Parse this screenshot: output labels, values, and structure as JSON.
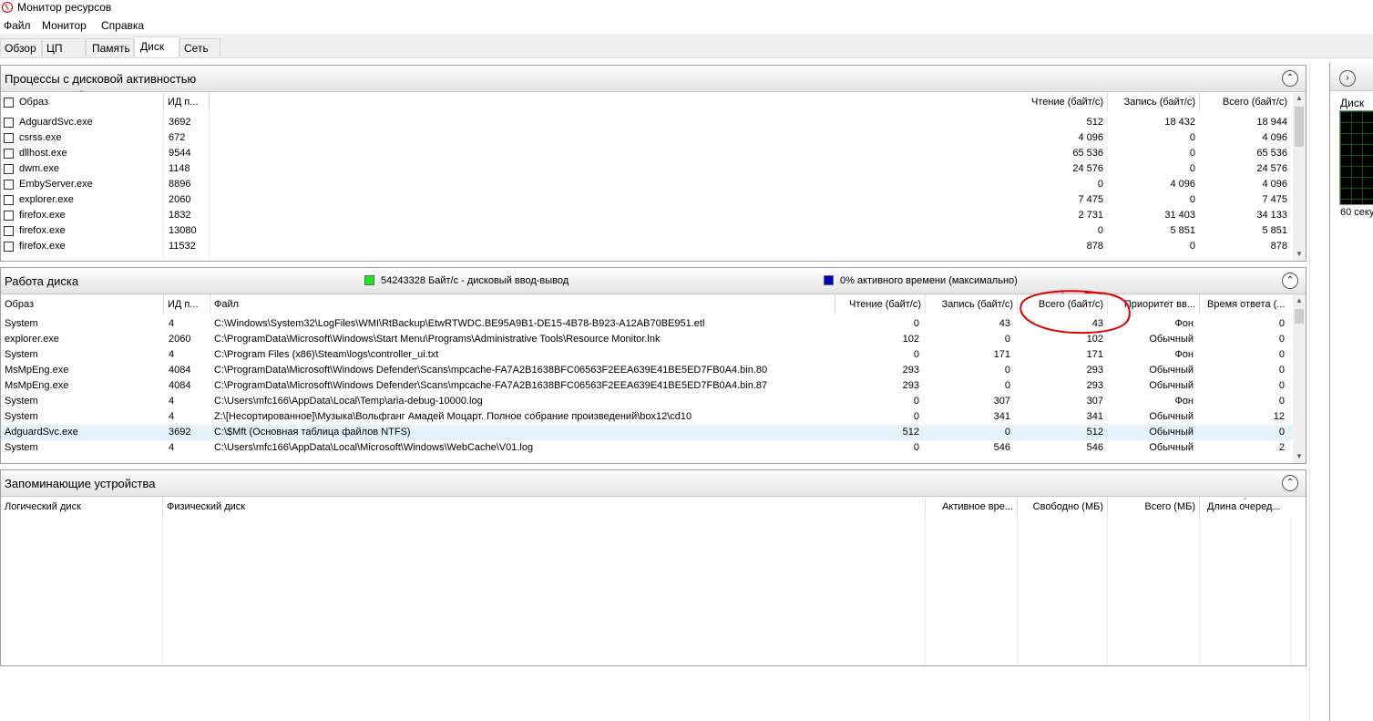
{
  "window": {
    "title": "Монитор ресурсов"
  },
  "menu": [
    "Файл",
    "Монитор",
    "Справка"
  ],
  "tabs": [
    "Обзор",
    "ЦП",
    "Память",
    "Диск",
    "Сеть"
  ],
  "processes": {
    "title": "Процессы с дисковой активностью",
    "columns": [
      "Образ",
      "ИД п...",
      "Чтение (байт/с)",
      "Запись (байт/с)",
      "Всего (байт/с)"
    ],
    "rows": [
      [
        "AdguardSvc.exe",
        "3692",
        "512",
        "18 432",
        "18 944"
      ],
      [
        "csrss.exe",
        "672",
        "4 096",
        "0",
        "4 096"
      ],
      [
        "dllhost.exe",
        "9544",
        "65 536",
        "0",
        "65 536"
      ],
      [
        "dwm.exe",
        "1148",
        "24 576",
        "0",
        "24 576"
      ],
      [
        "EmbyServer.exe",
        "8896",
        "0",
        "4 096",
        "4 096"
      ],
      [
        "explorer.exe",
        "2060",
        "7 475",
        "0",
        "7 475"
      ],
      [
        "firefox.exe",
        "1832",
        "2 731",
        "31 403",
        "34 133"
      ],
      [
        "firefox.exe",
        "13080",
        "0",
        "5 851",
        "5 851"
      ],
      [
        "firefox.exe",
        "11532",
        "878",
        "0",
        "878"
      ]
    ]
  },
  "disk_activity": {
    "title": "Работа диска",
    "io_legend": "54243328 Байт/с - дисковый ввод-вывод",
    "active_legend": "0% активного времени (максимально)",
    "io_color": "#1ee81e",
    "active_color": "#0000c0",
    "columns": [
      "Образ",
      "ИД п...",
      "Файл",
      "Чтение (байт/с)",
      "Запись (байт/с)",
      "Всего (байт/с)",
      "Приоритет вв...",
      "Время ответа (..."
    ],
    "rows": [
      [
        "System",
        "4",
        "C:\\Windows\\System32\\LogFiles\\WMI\\RtBackup\\EtwRTWDC.BE95A9B1-DE15-4B78-B923-A12AB70BE951.etl",
        "0",
        "43",
        "43",
        "Фон",
        "0"
      ],
      [
        "explorer.exe",
        "2060",
        "C:\\ProgramData\\Microsoft\\Windows\\Start Menu\\Programs\\Administrative Tools\\Resource Monitor.lnk",
        "102",
        "0",
        "102",
        "Обычный",
        "0"
      ],
      [
        "System",
        "4",
        "C:\\Program Files (x86)\\Steam\\logs\\controller_ui.txt",
        "0",
        "171",
        "171",
        "Фон",
        "0"
      ],
      [
        "MsMpEng.exe",
        "4084",
        "C:\\ProgramData\\Microsoft\\Windows Defender\\Scans\\mpcache-FA7A2B1638BFC06563F2EEA639E41BE5ED7FB0A4.bin.80",
        "293",
        "0",
        "293",
        "Обычный",
        "0"
      ],
      [
        "MsMpEng.exe",
        "4084",
        "C:\\ProgramData\\Microsoft\\Windows Defender\\Scans\\mpcache-FA7A2B1638BFC06563F2EEA639E41BE5ED7FB0A4.bin.87",
        "293",
        "0",
        "293",
        "Обычный",
        "0"
      ],
      [
        "System",
        "4",
        "C:\\Users\\mfc166\\AppData\\Local\\Temp\\aria-debug-10000.log",
        "0",
        "307",
        "307",
        "Фон",
        "0"
      ],
      [
        "System",
        "4",
        "Z:\\[Несортированное]\\Музыка\\Вольфганг Амадей Моцарт. Полное собрание произведений\\box12\\cd10",
        "0",
        "341",
        "341",
        "Обычный",
        "12"
      ],
      [
        "AdguardSvc.exe",
        "3692",
        "C:\\$Mft (Основная таблица файлов NTFS)",
        "512",
        "0",
        "512",
        "Обычный",
        "0"
      ],
      [
        "System",
        "4",
        "C:\\Users\\mfc166\\AppData\\Local\\Microsoft\\Windows\\WebCache\\V01.log",
        "0",
        "546",
        "546",
        "Обычный",
        "2"
      ]
    ]
  },
  "storage": {
    "title": "Запоминающие устройства",
    "columns": [
      "Логический диск",
      "Физический диск",
      "Активное вре...",
      "Свободно (МБ)",
      "Всего (МБ)",
      "Длина очеред..."
    ]
  },
  "right_panel": {
    "label": "Диск",
    "caption": "60 секу"
  }
}
